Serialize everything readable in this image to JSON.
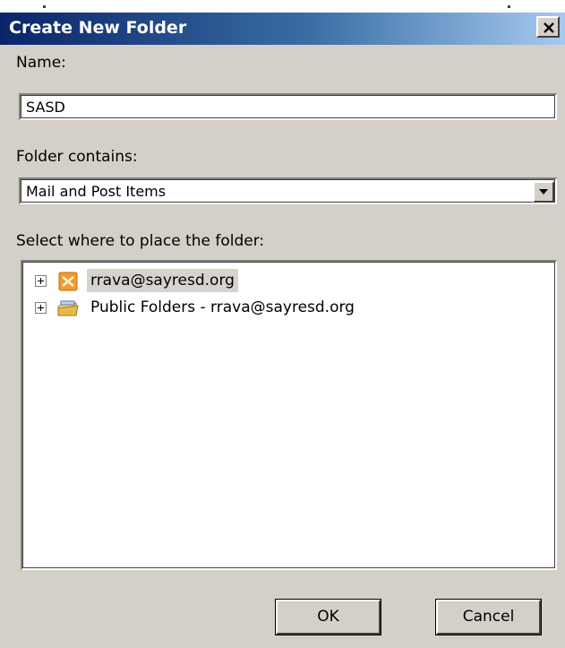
{
  "window": {
    "title": "Create New Folder",
    "close_label": "Close"
  },
  "name_field": {
    "label": "Name:",
    "value": "SASD"
  },
  "folder_contains": {
    "label": "Folder contains:",
    "selected": "Mail and Post Items"
  },
  "placement": {
    "label": "Select where to place the folder:",
    "items": [
      {
        "label": "rrava@sayresd.org",
        "icon": "exchange-mailbox-icon",
        "selected": true
      },
      {
        "label": "Public Folders - rrava@sayresd.org",
        "icon": "public-folders-icon",
        "selected": false
      }
    ]
  },
  "buttons": {
    "ok": "OK",
    "cancel": "Cancel"
  },
  "colors": {
    "title_gradient_start": "#0a246a",
    "title_gradient_end": "#a6caf0",
    "dialog_face": "#d4d0c8"
  }
}
